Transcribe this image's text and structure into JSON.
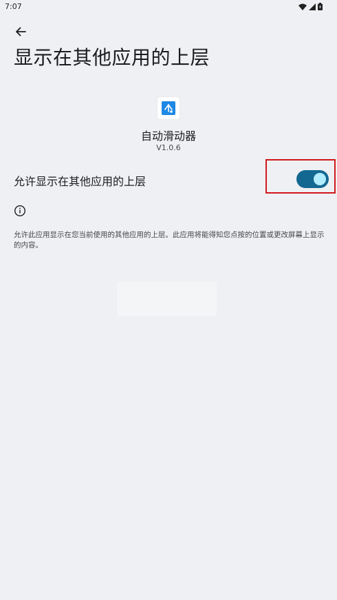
{
  "status_bar": {
    "time": "7:07"
  },
  "header": {
    "title": "显示在其他应用的上层"
  },
  "app": {
    "name": "自动滑动器",
    "version": "V1.0.6"
  },
  "permission": {
    "label": "允许显示在其他应用的上层",
    "enabled": true,
    "description": "允许此应用显示在您当前使用的其他应用的上层。此应用将能得知您点按的位置或更改屏幕上显示的内容。"
  },
  "colors": {
    "background": "#eff0f3",
    "switch_track": "#136891",
    "switch_thumb": "#b4ecff",
    "highlight": "#d0171b"
  },
  "icons": [
    "back-arrow-icon",
    "wifi-icon",
    "signal-icon",
    "battery-icon",
    "info-icon",
    "app-icon"
  ]
}
